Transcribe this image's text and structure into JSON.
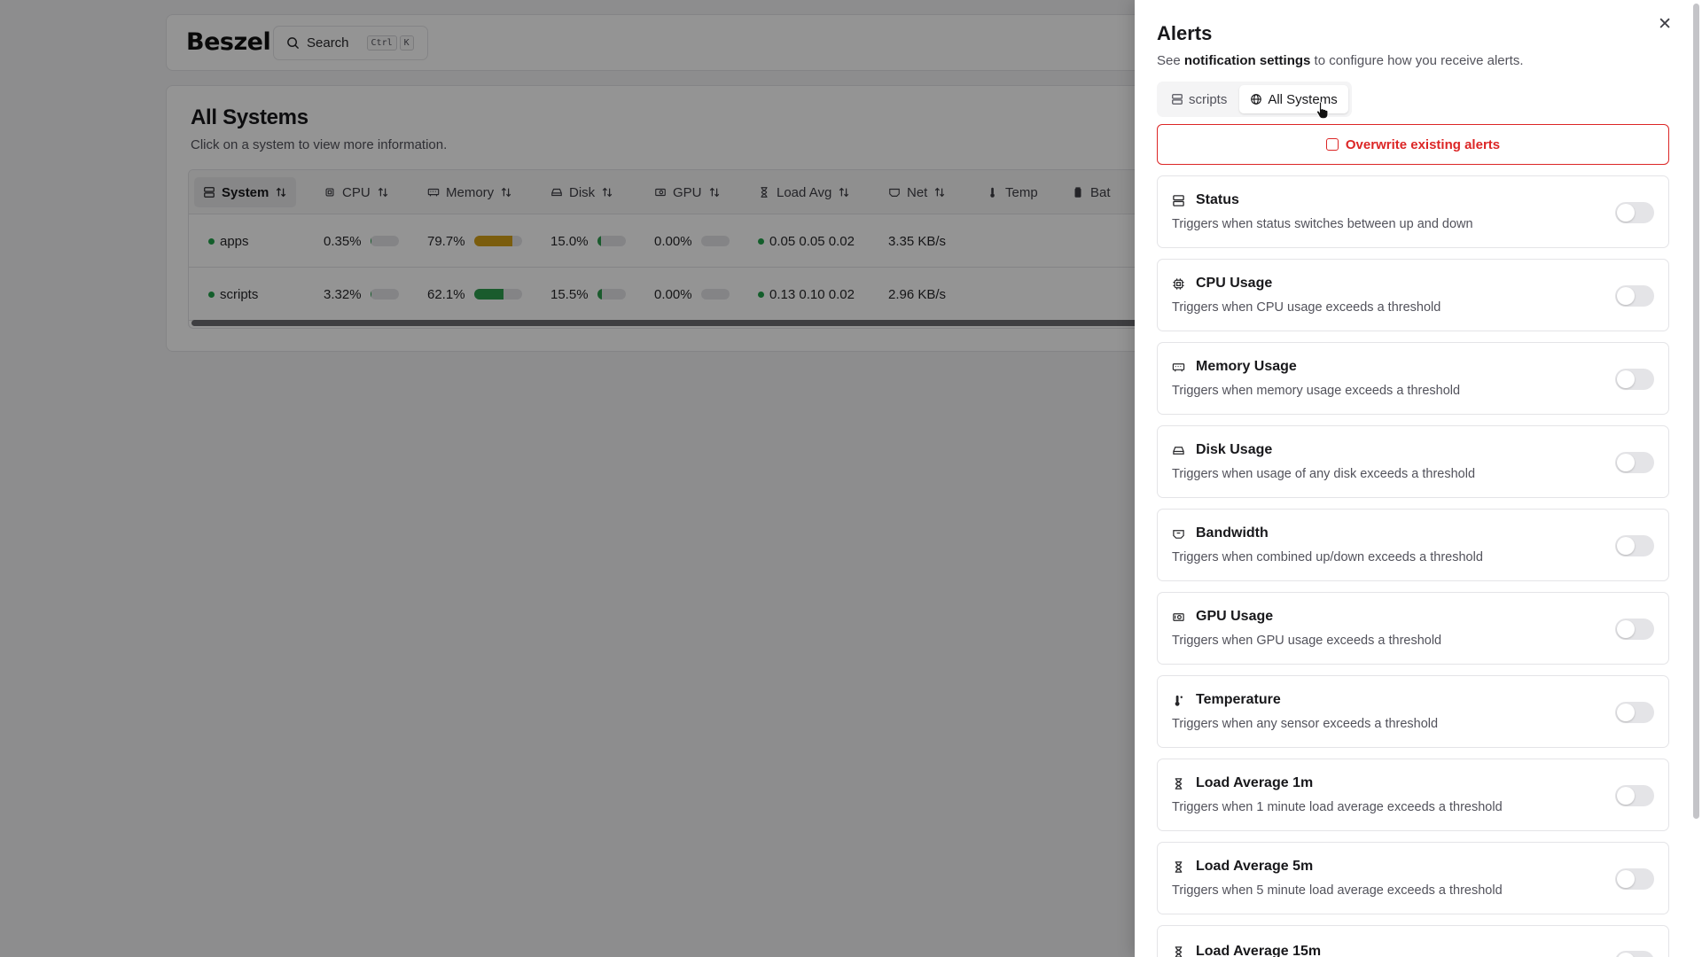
{
  "app": {
    "logo": "Beszel",
    "search": {
      "label": "Search",
      "keys": [
        "Ctrl",
        "K"
      ]
    }
  },
  "systems": {
    "title": "All Systems",
    "subtitle": "Click on a system to view more information.",
    "columns": [
      "System",
      "CPU",
      "Memory",
      "Disk",
      "GPU",
      "Load Avg",
      "Net",
      "Temp",
      "Bat"
    ],
    "rows": [
      {
        "name": "apps",
        "cpu": "0.35%",
        "cpu_pct": 0.35,
        "memory": "79.7%",
        "memory_pct": 79.7,
        "disk": "15.0%",
        "disk_pct": 15.0,
        "gpu": "0.00%",
        "gpu_pct": 0,
        "load": "0.05 0.05 0.02",
        "net": "3.35 KB/s"
      },
      {
        "name": "scripts",
        "cpu": "3.32%",
        "cpu_pct": 3.32,
        "memory": "62.1%",
        "memory_pct": 62.1,
        "disk": "15.5%",
        "disk_pct": 15.5,
        "gpu": "0.00%",
        "gpu_pct": 0,
        "load": "0.13 0.10 0.02",
        "net": "2.96 KB/s"
      }
    ],
    "colors": {
      "online": "#22a34b",
      "memory_warn": "#d4a017",
      "memory_ok": "#2e9e4f",
      "disk": "#2e9e4f"
    }
  },
  "panel": {
    "title": "Alerts",
    "subtitle_prefix": "See ",
    "subtitle_link": "notification settings",
    "subtitle_suffix": " to configure how you receive alerts.",
    "tabs": [
      {
        "label": "scripts",
        "icon": "server-icon"
      },
      {
        "label": "All Systems",
        "icon": "globe-icon"
      }
    ],
    "overwrite_label": "Overwrite existing alerts",
    "alerts": [
      {
        "title": "Status",
        "desc": "Triggers when status switches between up and down",
        "icon": "server-icon"
      },
      {
        "title": "CPU Usage",
        "desc": "Triggers when CPU usage exceeds a threshold",
        "icon": "cpu-icon"
      },
      {
        "title": "Memory Usage",
        "desc": "Triggers when memory usage exceeds a threshold",
        "icon": "memory-icon"
      },
      {
        "title": "Disk Usage",
        "desc": "Triggers when usage of any disk exceeds a threshold",
        "icon": "disk-icon"
      },
      {
        "title": "Bandwidth",
        "desc": "Triggers when combined up/down exceeds a threshold",
        "icon": "ethernet-icon"
      },
      {
        "title": "GPU Usage",
        "desc": "Triggers when GPU usage exceeds a threshold",
        "icon": "gpu-icon"
      },
      {
        "title": "Temperature",
        "desc": "Triggers when any sensor exceeds a threshold",
        "icon": "thermometer-icon"
      },
      {
        "title": "Load Average 1m",
        "desc": "Triggers when 1 minute load average exceeds a threshold",
        "icon": "hourglass-icon"
      },
      {
        "title": "Load Average 5m",
        "desc": "Triggers when 5 minute load average exceeds a threshold",
        "icon": "hourglass-icon"
      },
      {
        "title": "Load Average 15m",
        "desc": "",
        "icon": "hourglass-icon"
      }
    ]
  }
}
